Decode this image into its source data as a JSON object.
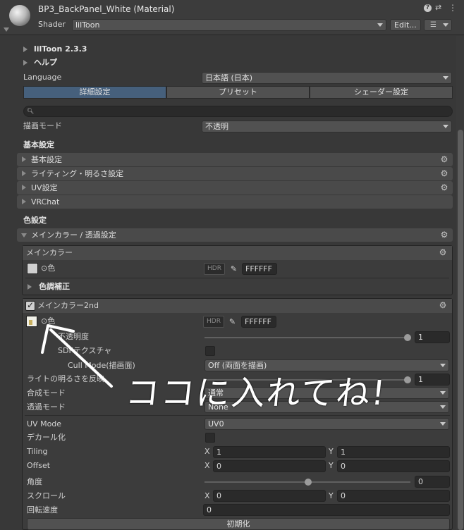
{
  "header": {
    "title": "BP3_BackPanel_White (Material)",
    "shader_label": "Shader",
    "shader_value": "lilToon",
    "edit_label": "Edit...",
    "help_icon": "?",
    "settings_icon": "⇄",
    "menu_icon": "⋮"
  },
  "sections": {
    "liltoon_version": "lilToon 2.3.3",
    "help": "ヘルプ",
    "language_label": "Language",
    "language_value": "日本語 (日本)",
    "tabs": [
      "詳細設定",
      "プリセット",
      "シェーダー設定"
    ],
    "render_mode_label": "描画モード",
    "render_mode_value": "不透明",
    "basic_settings_heading": "基本設定",
    "foldouts": [
      "基本設定",
      "ライティング・明るさ設定",
      "UV設定",
      "VRChat"
    ],
    "color_settings_heading": "色設定",
    "main_color_foldout": "メインカラー / 透過設定"
  },
  "main_color": {
    "header": "メインカラー",
    "color_label": "⊙色",
    "hdr": "HDR",
    "hex": "FFFFFF",
    "color_adjust": "色調補正",
    "swatch_color": "#cfcfcf"
  },
  "main_color_2nd": {
    "header": "メインカラー2nd",
    "enabled": true,
    "color_label": "⊙色",
    "hdr": "HDR",
    "hex": "FFFFFF",
    "opacity_label": "不透明度",
    "opacity_value": "1",
    "opacity_fraction": 1,
    "sdf_label": "SDFテクスチャ",
    "cull_label": "Cull Mode(描画面)",
    "cull_value": "Off (両面を描画)",
    "light_label": "ライトの明るさを反映",
    "light_value": "1",
    "light_fraction": 1,
    "blend_label": "合成モード",
    "blend_value": "通常",
    "alpha_label": "透過モード",
    "alpha_value": "None",
    "uvmode_label": "UV Mode",
    "uvmode_value": "UV0",
    "decal_label": "デカール化",
    "tiling_label": "Tiling",
    "tiling_x": "1",
    "tiling_y": "1",
    "offset_label": "Offset",
    "offset_x": "0",
    "offset_y": "0",
    "angle_label": "角度",
    "angle_value": "0",
    "angle_fraction": 0.5,
    "scroll_label": "スクロール",
    "scroll_x": "0",
    "scroll_y": "0",
    "rotation_label": "回転速度",
    "rotation_value": "0",
    "reset_label": "初期化",
    "x_label": "X",
    "y_label": "Y"
  },
  "annotation": {
    "text": "ココに入れてね!"
  }
}
